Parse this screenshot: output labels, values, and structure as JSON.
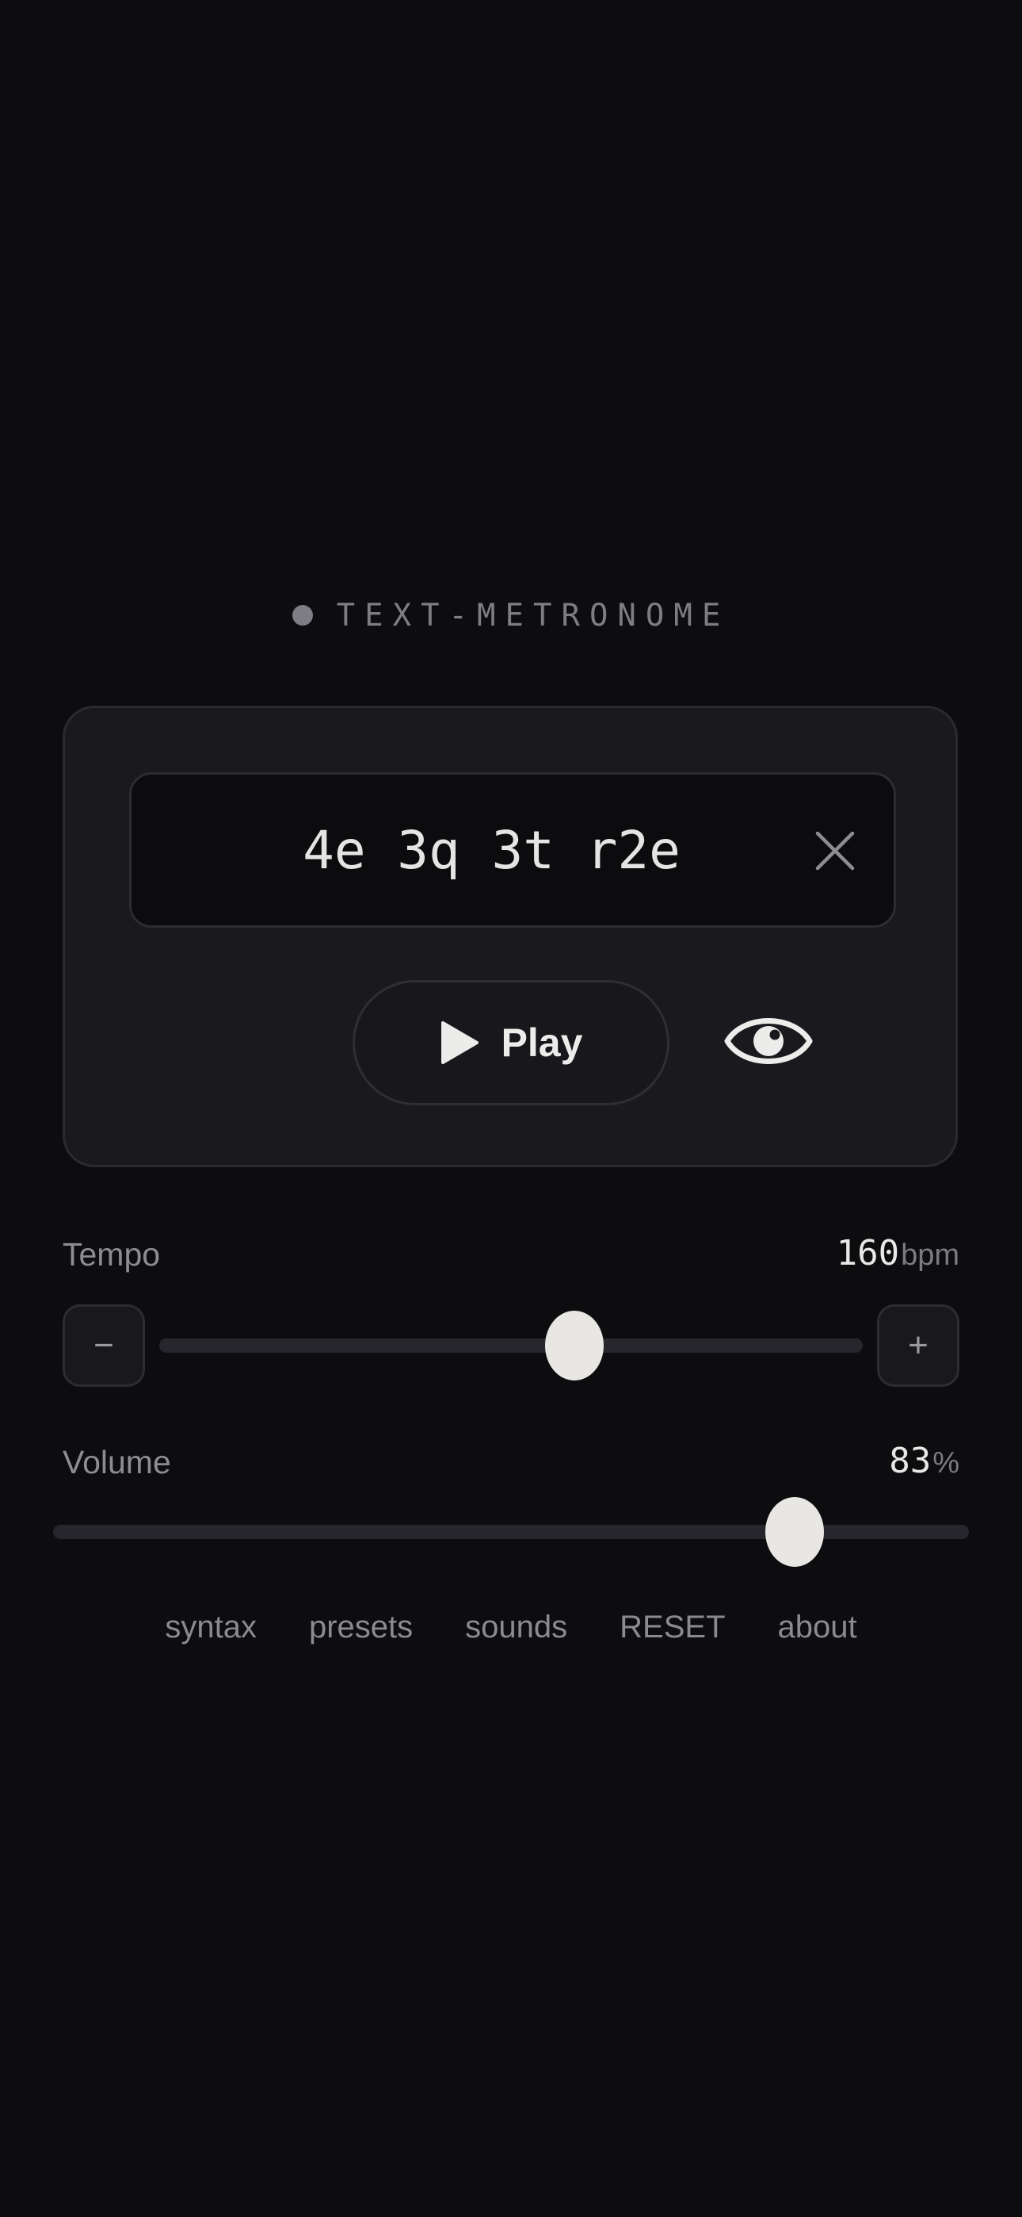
{
  "app": {
    "title": "TEXT-METRONOME"
  },
  "pattern": {
    "value": "4e 3q 3t r2e",
    "placeholder": ""
  },
  "controls": {
    "play_label": "Play"
  },
  "tempo": {
    "label": "Tempo",
    "value": "160",
    "unit": "bpm",
    "minus_label": "−",
    "plus_label": "+",
    "slider_fraction": 0.59
  },
  "volume": {
    "label": "Volume",
    "value": "83",
    "unit": "%",
    "slider_fraction": 0.81
  },
  "footer": {
    "links": [
      {
        "label": "syntax"
      },
      {
        "label": "presets"
      },
      {
        "label": "sounds"
      },
      {
        "label": "RESET"
      },
      {
        "label": "about"
      }
    ]
  },
  "icons": {
    "brand": "dot-icon",
    "clear": "close-icon",
    "play": "play-icon",
    "visualize": "eye-icon"
  },
  "colors": {
    "background": "#0d0d10",
    "card": "#1a1a1e",
    "thumb": "#e8e7e3",
    "muted": "#8a8a90"
  }
}
